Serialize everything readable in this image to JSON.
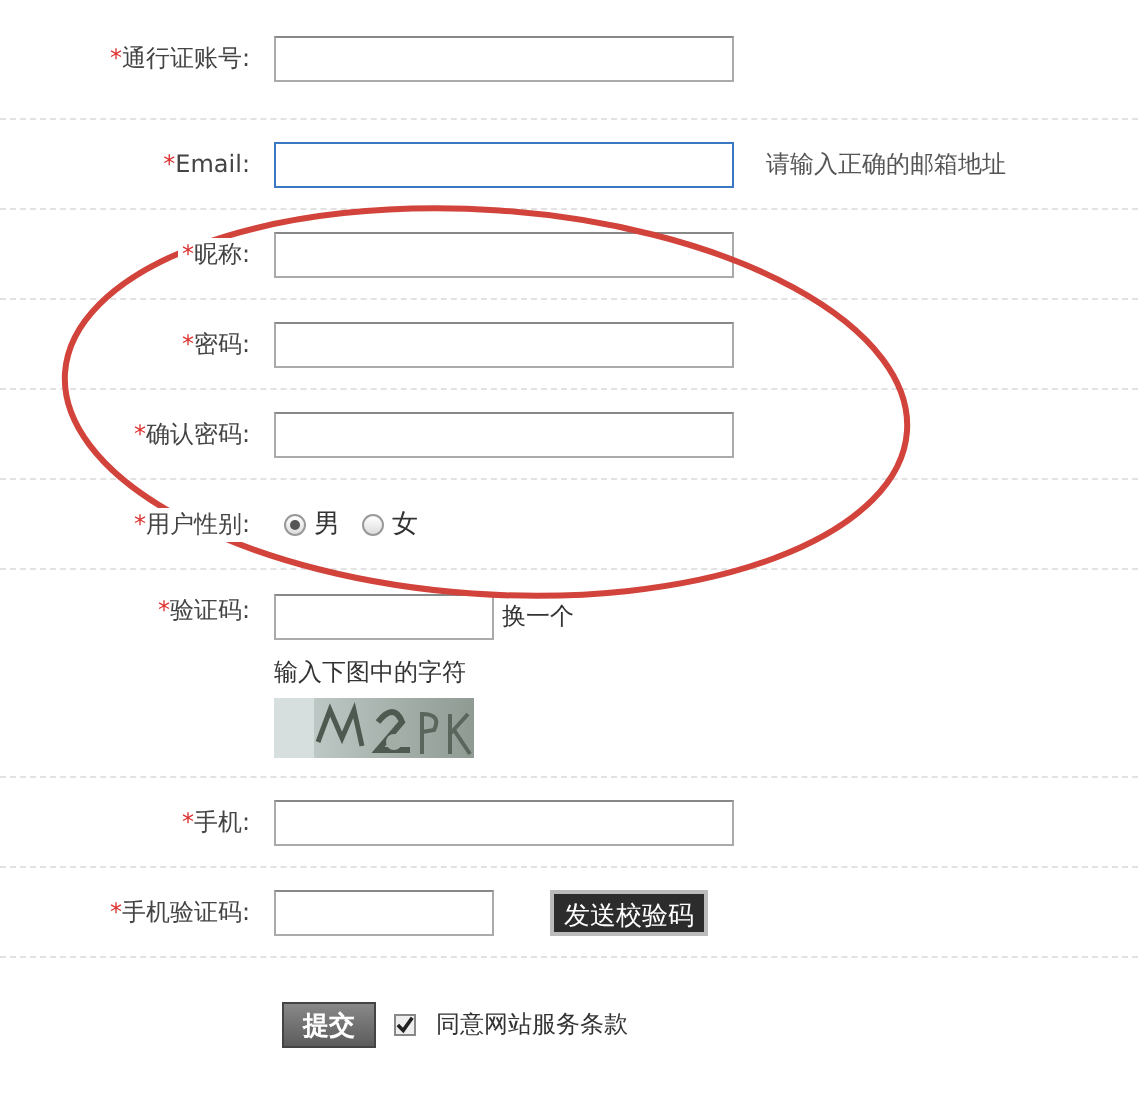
{
  "fields": [
    {
      "kind": "text",
      "required_mark": "*",
      "label": "通行证账号:",
      "focused": false
    },
    {
      "kind": "text",
      "required_mark": "*",
      "label": "Email:",
      "focused": true,
      "hint": "请输入正确的邮箱地址"
    },
    {
      "kind": "text",
      "required_mark": "*",
      "label": "昵称:",
      "focused": false
    },
    {
      "kind": "text",
      "required_mark": "*",
      "label": "密码:",
      "focused": false
    },
    {
      "kind": "text",
      "required_mark": "*",
      "label": "确认密码:",
      "focused": false
    },
    {
      "kind": "radio",
      "required_mark": "*",
      "label": "用户性别:",
      "options": [
        {
          "label": "男",
          "selected": true
        },
        {
          "label": "女",
          "selected": false
        }
      ]
    },
    {
      "kind": "captcha",
      "required_mark": "*",
      "label": "验证码:",
      "refresh_link": "换一个",
      "hint": "输入下图中的字符"
    },
    {
      "kind": "text",
      "required_mark": "*",
      "label": "手机:",
      "focused": false
    },
    {
      "kind": "sms",
      "required_mark": "*",
      "label": "手机验证码:",
      "button": "发送校验码"
    }
  ],
  "submit": {
    "label": "提交"
  },
  "agreement": {
    "label": "同意网站服务条款",
    "checked": true
  },
  "annotation": {
    "kind": "ellipse"
  }
}
